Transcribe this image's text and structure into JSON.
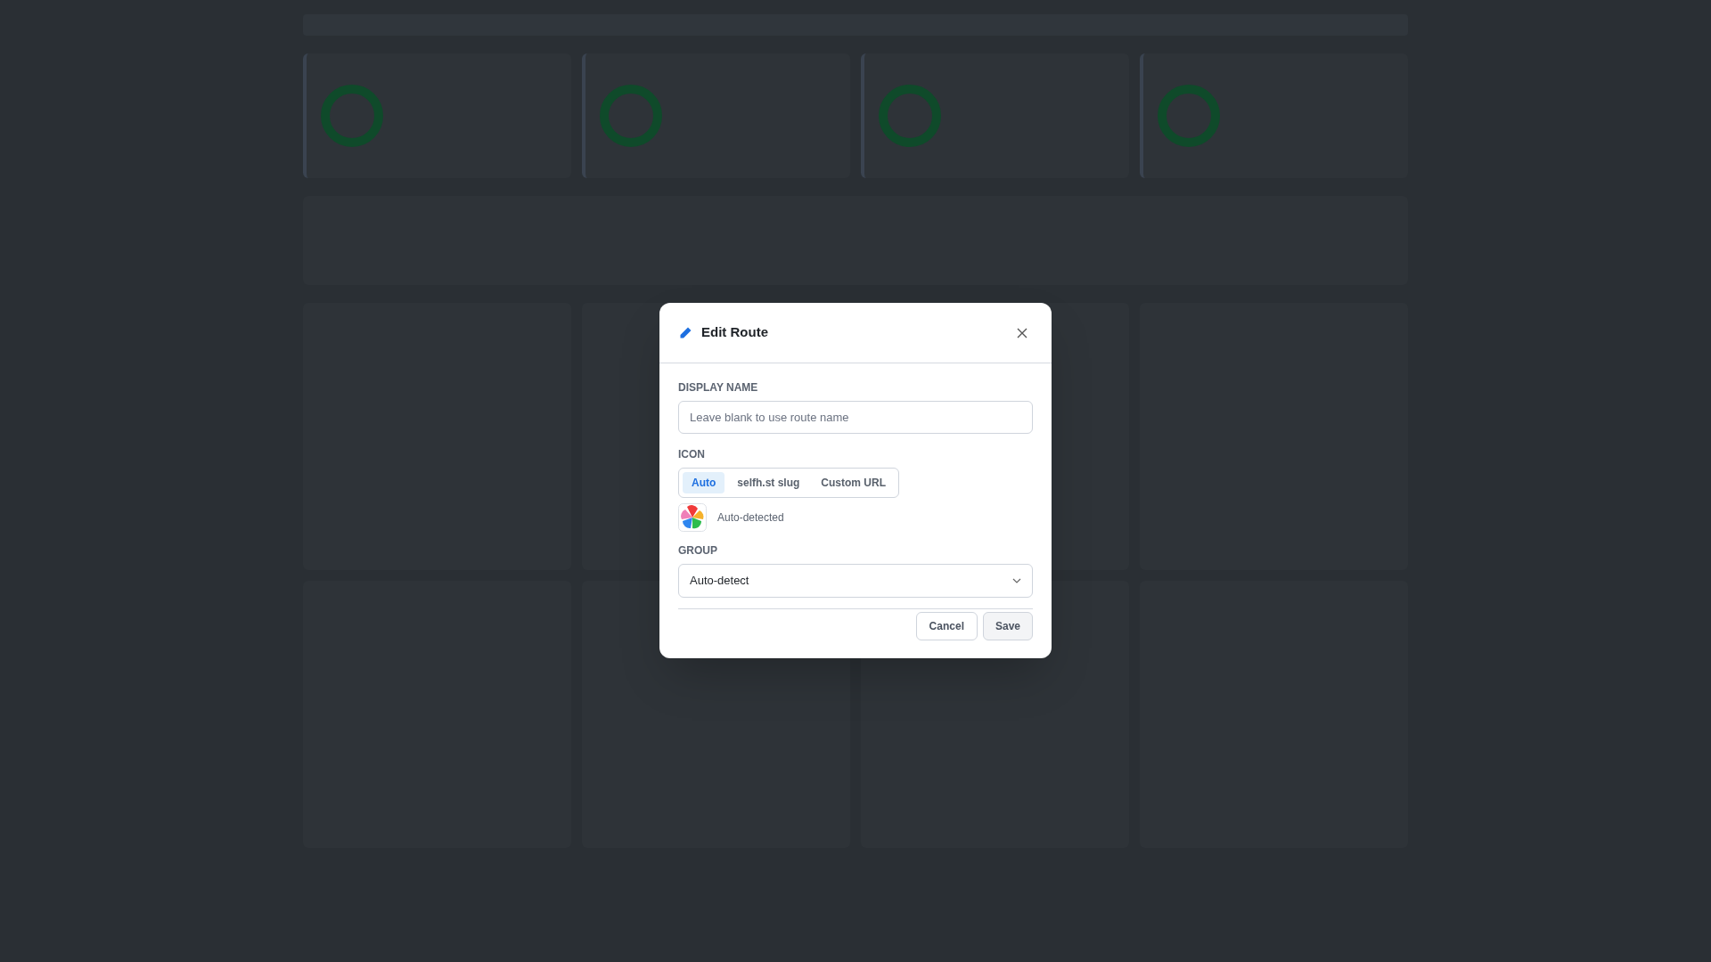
{
  "dialog": {
    "title": "Edit Route",
    "display_name": {
      "label": "DISPLAY NAME",
      "placeholder": "Leave blank to use route name"
    },
    "icon": {
      "label": "ICON",
      "modes": [
        {
          "label": "Auto",
          "selected": true
        },
        {
          "label": "selfh.st slug",
          "selected": false
        },
        {
          "label": "Custom URL",
          "selected": false
        }
      ],
      "preview_label": "Auto-detected"
    },
    "group": {
      "label": "GROUP",
      "value": "Auto-detect"
    },
    "buttons": [
      {
        "label": "Cancel",
        "kind": "secondary"
      },
      {
        "label": "Save",
        "kind": "primary"
      }
    ]
  }
}
